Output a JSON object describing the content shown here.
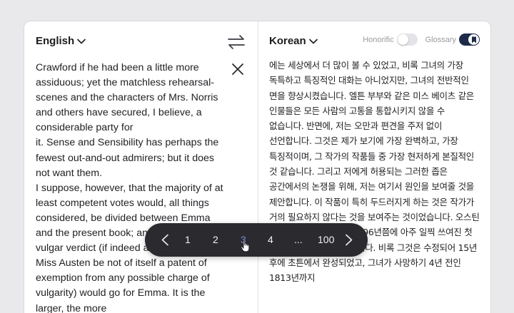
{
  "source": {
    "language": "English",
    "text": "Crawford if he had been a little more assiduous; yet the matchless rehearsal-scenes and the characters of Mrs. Norris and others have secured, I believe, a considerable party for\nit. Sense and Sensibility has perhaps the fewest out-and-out admirers; but it does not want them.\nI suppose, however, that the majority of at least competent votes would, all things considered, be divided between Emma and the present book; and perhaps the vulgar verdict (if indeed a fondness for Miss Austen be not of itself a patent of exemption from any possible charge of vulgarity) would go for Emma. It is the larger, the more"
  },
  "target": {
    "language": "Korean",
    "honorific_label": "Honorific",
    "glossary_label": "Glossary",
    "honorific_on": false,
    "glossary_on": true,
    "text": "에는 세상에서 더 많이 볼 수 있었고, 비록 그녀의 가장 독특하고 특징적인 대화는 아니었지만, 그녀의 전반적인 면을 향상시켰습니다. 엘튼 부부와 같은 미스 베이츠 같은 인물들은 모든 사람의 고통을 통합시키지 않을 수 없습니다. 반면에, 저는 오만과 편견을 주저 없이 선언합니다. 그것은 제가 보기에 가장 완벽하고, 가장 특징적이며, 그 작가의 작품들 중 가장 현저하게 본질적인 것 같습니다. 그리고 저에게 허용되는 그러한 좁은 공간에서의 논쟁을 위해, 저는 여기서 원인을 보여줄 것을 제안합니다. 이 작품이 특히 두드러지게 하는 것은 작가가 거의 필요하지 않다는 것을 보여주는 것이었습니다. 오스틴 양이 겨우 21살이었던 1796년쯤에 아주 일찍 쓰여진 첫 번째 형태로 되어 있었습니다. 비록 그것은 수정되어 15년 후에 초튼에서 완성되었고, 그녀가 사망하기 4년 전인 1813년까지"
  },
  "pager": {
    "pages": [
      "1",
      "2",
      "3",
      "4",
      "...",
      "100"
    ],
    "current": "3"
  },
  "colors": {
    "background": "#e9e9ec",
    "pager_bg": "#2b2b2f",
    "pager_active": "#7f8bd8",
    "glossary_on": "#1d2a4a"
  }
}
